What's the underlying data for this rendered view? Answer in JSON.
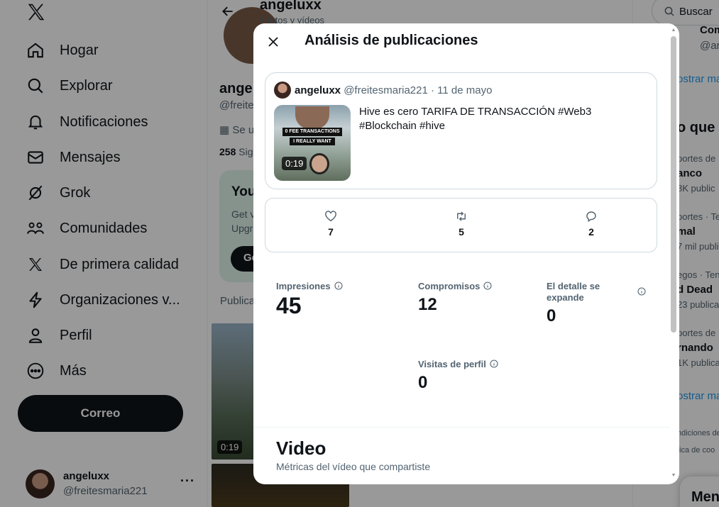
{
  "sidebar": {
    "items": [
      {
        "label": "Hogar",
        "icon": "home-icon"
      },
      {
        "label": "Explorar",
        "icon": "search-icon"
      },
      {
        "label": "Notificaciones",
        "icon": "bell-icon"
      },
      {
        "label": "Mensajes",
        "icon": "mail-icon"
      },
      {
        "label": "Grok",
        "icon": "grok-icon"
      },
      {
        "label": "Comunidades",
        "icon": "communities-icon"
      },
      {
        "label": "De primera calidad",
        "icon": "x-premium-icon"
      },
      {
        "label": "Organizaciones v...",
        "icon": "lightning-icon"
      },
      {
        "label": "Perfil",
        "icon": "person-icon"
      },
      {
        "label": "Más",
        "icon": "more-circle-icon"
      }
    ],
    "post_button": "Correo",
    "account": {
      "name": "angeluxx",
      "handle": "@freitesmaria221",
      "more": "···"
    }
  },
  "profile": {
    "header_title": "angeluxx",
    "header_sub": "4 fotos y vídeos",
    "name": "ange",
    "handle": "@freite",
    "joined": "Se u",
    "follow_count": "258",
    "follow_label": "Sig",
    "premium": {
      "title": "You",
      "desc1": "Get v",
      "desc2": "Upgr",
      "button": "Ge"
    },
    "tab": "Publica",
    "tile_duration": "0:19"
  },
  "right": {
    "search_placeholder": "Buscar",
    "top_name": "Com",
    "top_handle": "@ar",
    "show_more_1": "ostrar ma",
    "section_title": "o que e",
    "trends": [
      {
        "ctx": "portes de",
        "name": "anco",
        "count": "8K public"
      },
      {
        "ctx": "portes · Te",
        "name": "mal",
        "count": "7 mil publi"
      },
      {
        "ctx": "egos · Tend",
        "name": "d Dead",
        "count": "23 publica"
      },
      {
        "ctx": "portes de",
        "name": "rnando",
        "count": "1K publica"
      }
    ],
    "show_more_2": "ostrar ma",
    "footer1": "ndiciones de",
    "footer2": "tica de coo",
    "messages_pill": "Men"
  },
  "modal": {
    "title": "Análisis de publicaciones",
    "post": {
      "name": "angeluxx",
      "handle": "@freitesmaria221",
      "date": "11 de mayo",
      "text": "Hive es cero TARIFA DE TRANSACCIÓN #Web3 #Blockchain #hive",
      "thumb_caption_1": "0 FEE TRANSACTIONS",
      "thumb_caption_2": "I REALLY WANT",
      "duration": "0:19"
    },
    "engagement": {
      "likes": "7",
      "reposts": "5",
      "replies": "2"
    },
    "metrics": {
      "impressions_label": "Impresiones",
      "impressions_value": "45",
      "engagements_label": "Compromisos",
      "engagements_value": "12",
      "detail_label": "El detalle se expande",
      "detail_value": "0",
      "profile_visits_label": "Visitas de perfil",
      "profile_visits_value": "0"
    },
    "video_section": {
      "title": "Video",
      "subtitle": "Métricas del vídeo que compartiste"
    }
  }
}
